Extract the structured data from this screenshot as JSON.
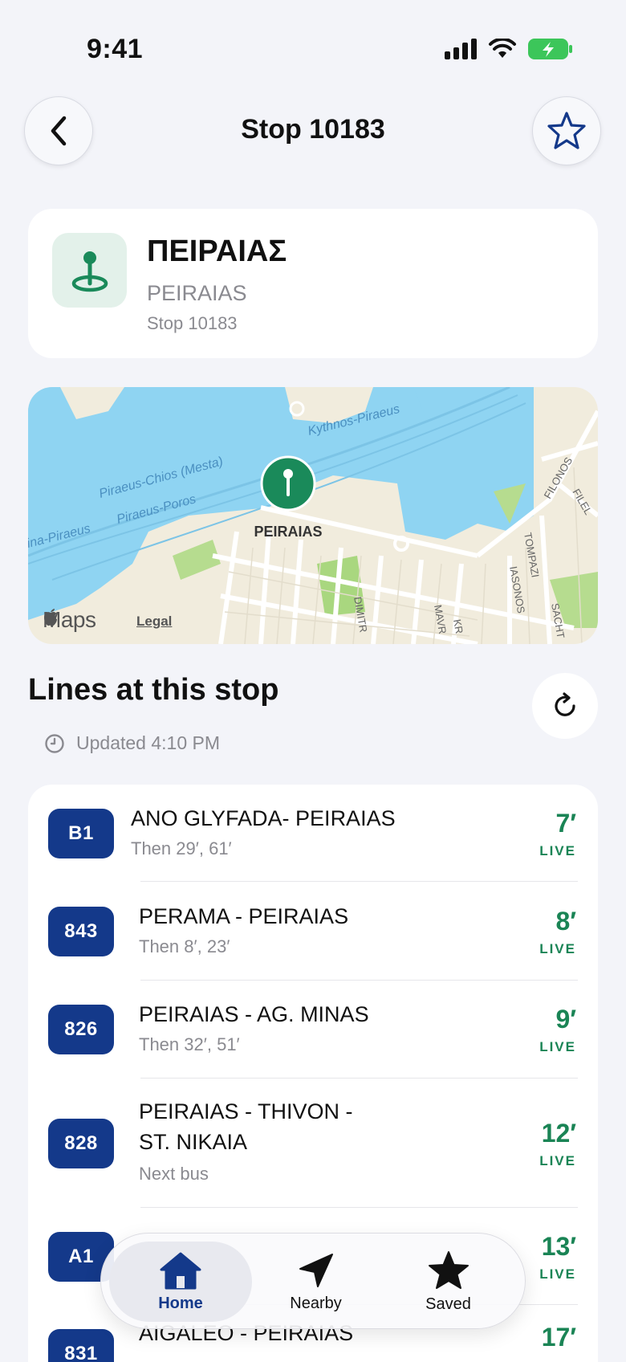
{
  "status_bar": {
    "time": "9:41"
  },
  "header": {
    "title": "Stop 10183"
  },
  "stop": {
    "name_el": "ΠΕΙΡΑΙΑΣ",
    "name_latin": "PEIRAIAS",
    "code": "Stop 10183"
  },
  "map": {
    "labels": {
      "kythnos": "Kythnos-Piraeus",
      "chios": "Piraeus-Chios (Mesta)",
      "poros": "Piraeus-Poros",
      "aegina": "ina-Piraeus",
      "pin": "PEIRAIAS",
      "filonos": "FILONOS",
      "filel": "FILEL",
      "tompazi": "TOMPAZI",
      "iasonos": "IASONOS",
      "sacht": "SACHT",
      "dimitr": "DIMITR",
      "mavr": "MAVR",
      "kr": "KR"
    },
    "brand": "Maps",
    "legal": "Legal"
  },
  "lines_section": {
    "title": "Lines at this stop",
    "updated": "Updated 4:10 PM"
  },
  "lines": [
    {
      "code": "B1",
      "name": "ANO GLYFADA- PEIRAIAS",
      "sub": "Then 29′, 61′",
      "eta": "7′",
      "live": "LIVE"
    },
    {
      "code": "843",
      "name": "PERAMA - PEIRAIAS",
      "sub": "Then 8′, 23′",
      "eta": "8′",
      "live": "LIVE"
    },
    {
      "code": "826",
      "name": "PEIRAIAS - AG. MINAS",
      "sub": "Then 32′, 51′",
      "eta": "9′",
      "live": "LIVE"
    },
    {
      "code": "828",
      "name_line1": "PEIRAIAS - THIVON -",
      "name_line2": "ST. NIKAIA",
      "sub": "Next bus",
      "eta": "12′",
      "live": "LIVE"
    },
    {
      "code": "A1",
      "eta": "13′",
      "live": "LIVE"
    },
    {
      "code": "831",
      "name": "AIGALEO - PEIRAIAS",
      "eta": "17′"
    }
  ],
  "tabs": [
    {
      "label": "Home",
      "icon": "home-icon"
    },
    {
      "label": "Nearby",
      "icon": "location-arrow-icon"
    },
    {
      "label": "Saved",
      "icon": "star-icon"
    }
  ],
  "colors": {
    "accent_blue": "#14398a",
    "live_green": "#1a8455",
    "pin_green": "#1a8a5a",
    "water": "#8fd4f2",
    "land": "#f1ecdd"
  }
}
